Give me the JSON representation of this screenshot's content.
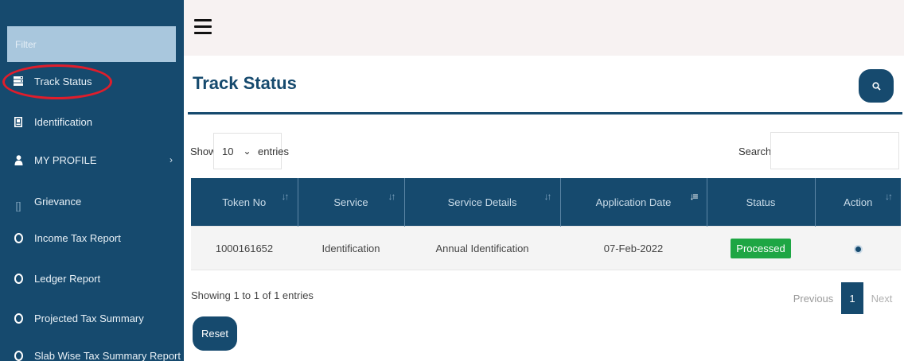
{
  "sidebar": {
    "filter_placeholder": "Filter",
    "items": [
      {
        "label": "Track Status",
        "icon": "server-icon"
      },
      {
        "label": "Identification",
        "icon": "id-card-icon"
      },
      {
        "label": "MY PROFILE",
        "icon": "user-icon",
        "chevron": "›"
      },
      {
        "label": "Grievance",
        "icon": "grievance-icon"
      },
      {
        "label": "Income Tax Report",
        "icon": "circle-icon"
      },
      {
        "label": "Ledger Report",
        "icon": "circle-icon"
      },
      {
        "label": "Projected Tax Summary",
        "icon": "circle-icon"
      },
      {
        "label": "Slab Wise Tax Summary Report",
        "icon": "circle-icon"
      }
    ]
  },
  "page": {
    "title": "Track Status"
  },
  "table_controls": {
    "show_label": "Show",
    "page_length": "10",
    "entries_label": "entries",
    "search_label": "Search:"
  },
  "table": {
    "columns": [
      "Token No",
      "Service",
      "Service Details",
      "Application Date",
      "Status",
      "Action"
    ],
    "rows": [
      {
        "token_no": "1000161652",
        "service": "Identification",
        "service_details": "Annual Identification",
        "application_date": "07-Feb-2022",
        "status": "Processed",
        "action_icon": "eye-icon"
      }
    ]
  },
  "footer": {
    "info": "Showing 1 to 1 of 1 entries",
    "previous": "Previous",
    "current_page": "1",
    "next": "Next",
    "reset": "Reset"
  },
  "colors": {
    "primary": "#164a6e",
    "status_processed": "#1ea644",
    "highlight": "#e01d2b"
  }
}
